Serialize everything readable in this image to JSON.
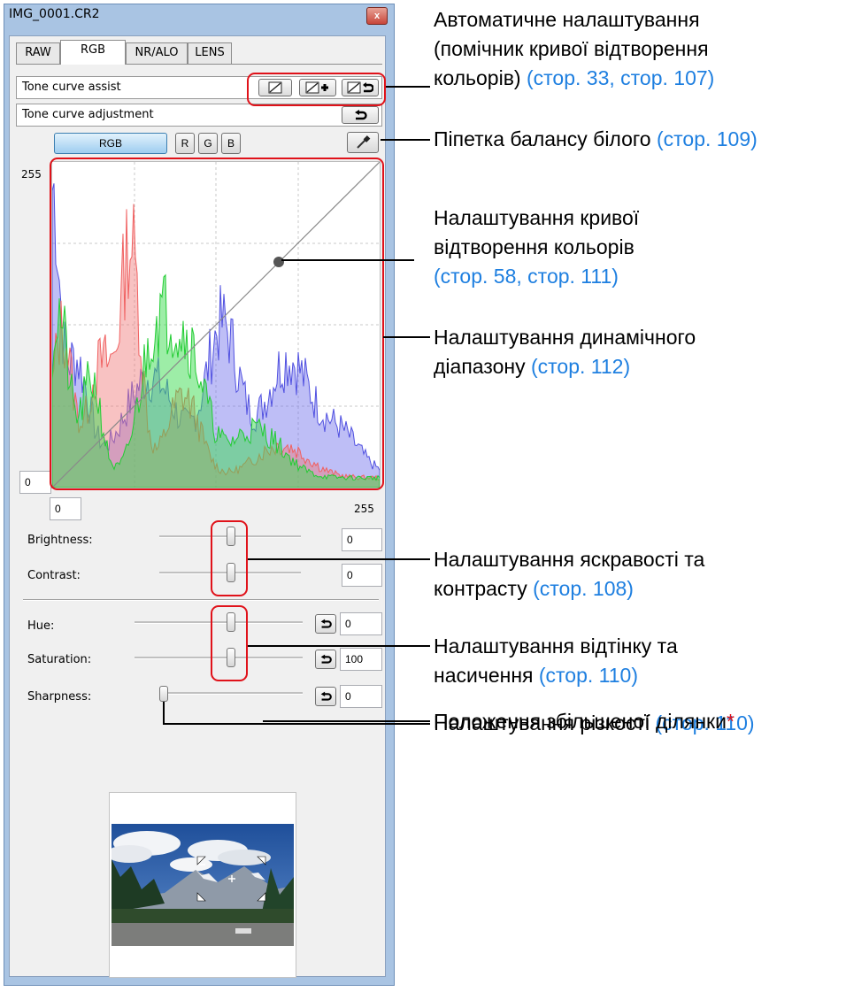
{
  "window": {
    "title": "IMG_0001.CR2",
    "close_glyph": "x",
    "tabs": [
      {
        "label": "RAW",
        "active": false
      },
      {
        "label": "RGB",
        "active": true
      },
      {
        "label": "NR/ALO",
        "active": false
      },
      {
        "label": "LENS",
        "active": false
      }
    ]
  },
  "tone_curve_assist": {
    "label": "Tone curve assist",
    "buttons": [
      "linear-curve-icon",
      "curve-plus-icon",
      "curve-reset-icon"
    ]
  },
  "tone_curve_adjustment": {
    "label": "Tone curve adjustment",
    "reset_icon": "undo-icon"
  },
  "channels": {
    "rgb": "RGB",
    "r": "R",
    "g": "G",
    "b": "B",
    "eyedropper_icon": "eyedropper-icon"
  },
  "graph": {
    "y_max": "255",
    "y_min": "0",
    "x_min": "0",
    "x_max": "255",
    "histogram_colors": {
      "red": "#f07070",
      "green": "#22cc33",
      "blue": "#5050e0"
    }
  },
  "sliders": {
    "brightness": {
      "label": "Brightness:",
      "value": "0",
      "level": 0.5
    },
    "contrast": {
      "label": "Contrast:",
      "value": "0",
      "level": 0.5
    },
    "hue": {
      "label": "Hue:",
      "value": "0",
      "level": 0.5
    },
    "saturation": {
      "label": "Saturation:",
      "value": "100",
      "level": 0.5
    },
    "sharpness": {
      "label": "Sharpness:",
      "value": "0",
      "level": 0.0
    }
  },
  "annotations": {
    "tone_curve_assist": {
      "text": "Автоматичне налаштування\n(помічник кривої відтворення\nкольорів) ",
      "link": "(стор. 33, стор. 107)"
    },
    "white_balance": {
      "text": "Піпетка балансу білого ",
      "link": "(стор. 109)"
    },
    "tone_curve": {
      "text": "Налаштування кривої\nвідтворення кольорів\n",
      "link": "(стор. 58, стор. 111)"
    },
    "dynamic_range": {
      "text": "Налаштування динамічного\nдіапазону ",
      "link": "(стор. 112)"
    },
    "brightness_contrast": {
      "text": "Налаштування яскравості та\nконтрасту ",
      "link": "(стор. 108)"
    },
    "hue_saturation": {
      "text": "Налаштування відтінку та\nнасичення ",
      "link": "(стор. 110)"
    },
    "sharpness": {
      "text": "Налаштування різкості ",
      "link": "(стор. 110)"
    },
    "magnified_area": {
      "text": "Положення збільшеної ділянки",
      "star": "*"
    }
  },
  "colors": {
    "highlight_red": "#e0121a",
    "link_blue": "#1e7fe0",
    "rgb_button": "#9ecdf0"
  }
}
